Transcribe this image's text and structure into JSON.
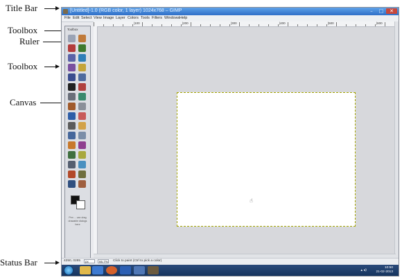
{
  "callouts": {
    "title_bar": "Title Bar",
    "toolbox_top": "Toolbox",
    "ruler": "Ruler",
    "toolbox_left": "Toolbox",
    "canvas": "Canvas",
    "status_bar": "Status Bar"
  },
  "window": {
    "title": "[Untitled]-1.0 (RGB color, 1 layer) 1024x768 – GIMP",
    "controls": [
      "–",
      "□",
      "✕"
    ]
  },
  "menu": [
    "File",
    "Edit",
    "Select",
    "View",
    "Image",
    "Layer",
    "Colors",
    "Tools",
    "Filters",
    "Windows",
    "Help"
  ],
  "toolbox": {
    "title": "Toolbox",
    "tool_options_text": "Pen ... can drag drawable dialogs here"
  },
  "ruler": {
    "labels": [
      "|100",
      "|200",
      "|300",
      "|400",
      "|500",
      "|600"
    ]
  },
  "statusbar": {
    "coords": "4250, 0285",
    "unit": "px",
    "zoom": "66.7%",
    "message": "Click to paint (Ctrl to pick a color)"
  },
  "taskbar": {
    "clock_time": "10:50",
    "clock_date": "21-02-2013"
  },
  "colors": {
    "title_bar": "#2f6fc7",
    "taskbar": "#16345e",
    "canvas_border": "#a3a300"
  }
}
